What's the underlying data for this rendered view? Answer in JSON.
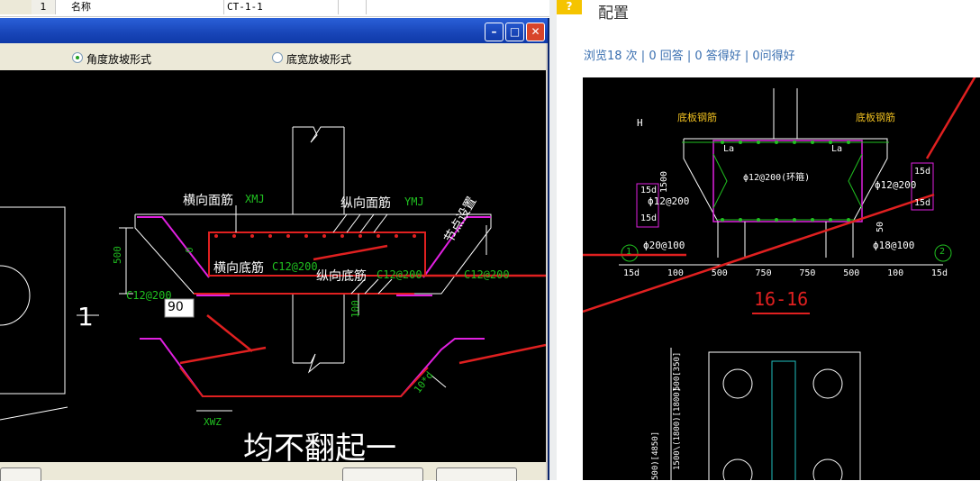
{
  "property_table": {
    "row_number": "1",
    "row_label": "名称",
    "row_value": "CT-1-1"
  },
  "options": {
    "angle_slope": "角度放坡形式",
    "width_slope": "底宽放坡形式"
  },
  "drawing": {
    "label_transverse_top": "横向面筋",
    "code_transverse_top": "XMJ",
    "label_longitudinal_top": "纵向面筋",
    "code_longitudinal_top": "YMJ",
    "label_node_setting": "节点设置",
    "label_transverse_bottom": "横向底筋",
    "code_transverse_bottom": "C12@200",
    "label_longitudinal_bottom": "纵向底筋",
    "code_longitudinal_bottom": "C12@200",
    "code_left": "C12@200",
    "code_right": "C12@200",
    "dim_500": "500",
    "dim_0": "0",
    "dim_100": "100",
    "angle_input": "90",
    "label_1": "1",
    "label_xwz": "XWZ",
    "label_10d": "10*d",
    "caption": "均不翻起一"
  },
  "web": {
    "section_title": "配置",
    "stats": "浏览18 次 | 0 回答 | 0 答得好 | 0问得好"
  },
  "cad": {
    "bottom_rebar_left": "底板钢筋",
    "bottom_rebar_right": "底板钢筋",
    "h_mark": "H",
    "la_left": "La",
    "la_right": "La",
    "dim_1500": "1500",
    "hoop": "ϕ12@200(环箍)",
    "left_15d_top": "15d",
    "left_15d_mid": "15d",
    "left_bar": "ϕ12@200",
    "right_bar": "ϕ12@200",
    "right_15d_top": "15d",
    "right_15d_bot": "15d",
    "dim_50": "50",
    "bar_20": "ϕ20@100",
    "bar_18": "ϕ18@100",
    "axis_1": "1",
    "axis_2": "2",
    "dims_bottom": [
      "15d",
      "100",
      "500",
      "750",
      "750",
      "500",
      "100",
      "15d"
    ],
    "section_label": "16-16",
    "dim_500_350": "500[350]",
    "dim_1500_1800": "1500\\(1800)[1800]",
    "dim_4850": "500)[4850]"
  },
  "colors": {
    "accent_red": "#e02020",
    "green": "#20c020",
    "magenta": "#e020e0",
    "link_blue": "#3a6fb0",
    "title_blue": "#1845b8"
  }
}
